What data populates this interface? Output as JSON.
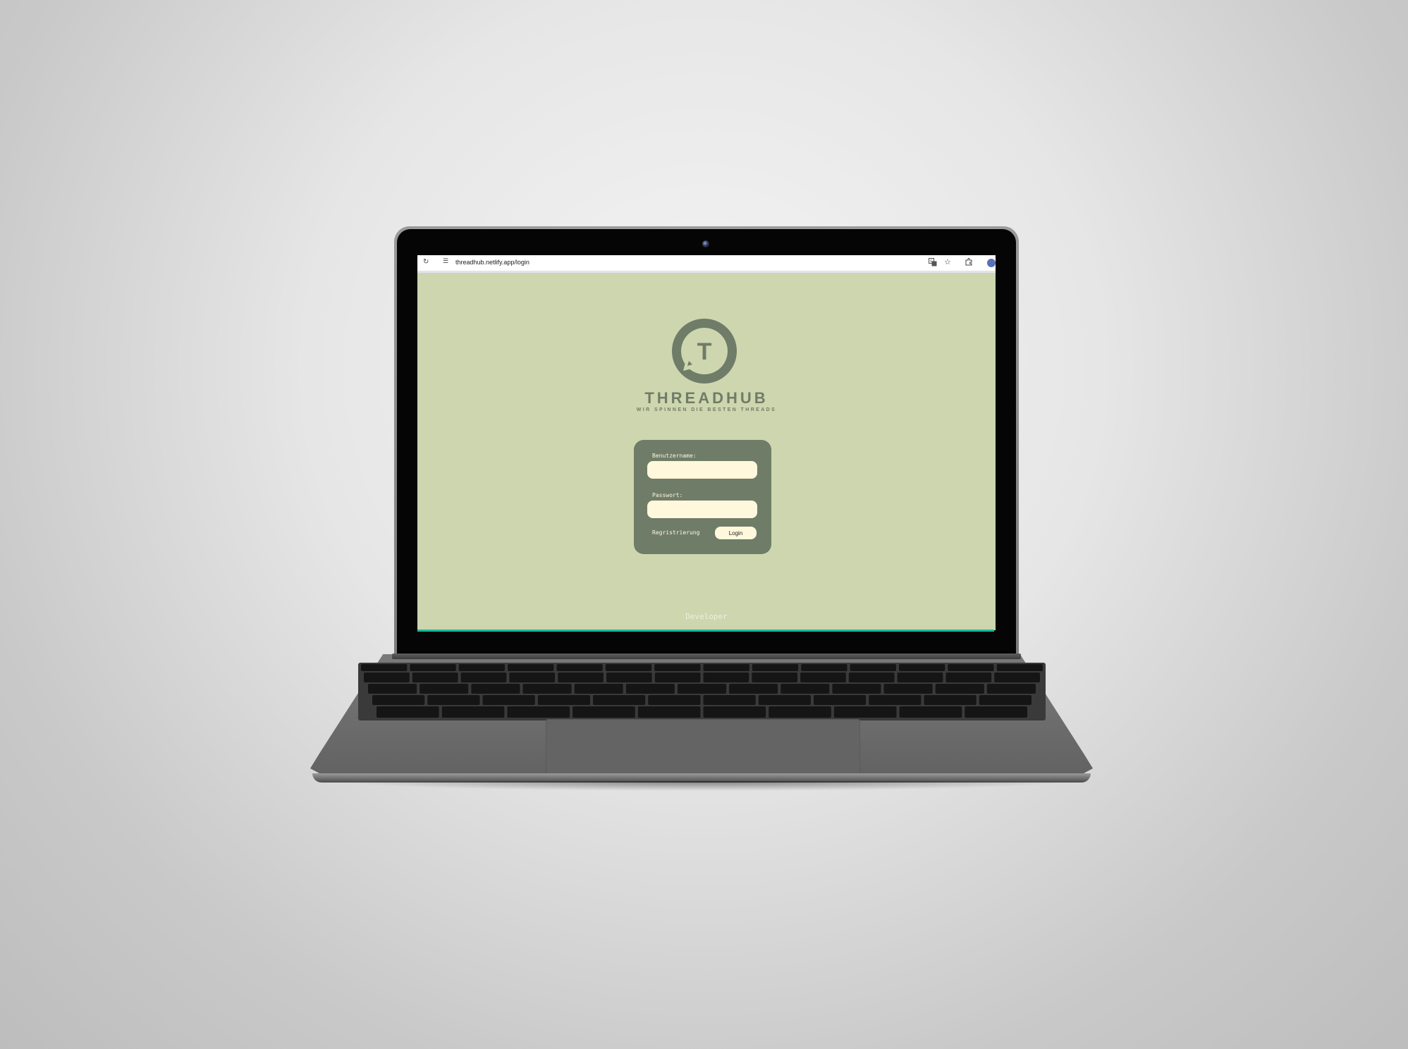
{
  "browser": {
    "url": "threadhub.netlify.app/login",
    "reload_icon": "reload-icon",
    "site_info_icon": "site-info-icon",
    "translate_icon": "translate-icon",
    "bookmark_icon": "star-icon",
    "extensions_icon": "puzzle-icon"
  },
  "brand": {
    "letter": "T",
    "name": "THREADHUB",
    "tagline": "WIR SPINNEN DIE BESTEN THREADS"
  },
  "login_form": {
    "username_label": "Benutzername:",
    "username_value": "",
    "password_label": "Passwort:",
    "password_value": "",
    "register_label": "Regristrierung",
    "login_label": "Login"
  },
  "footer": {
    "developer_label": "Developer"
  },
  "colors": {
    "page_background": "#cdd6ae",
    "brand_green": "#6f7c68",
    "cream": "#fff8dc"
  }
}
